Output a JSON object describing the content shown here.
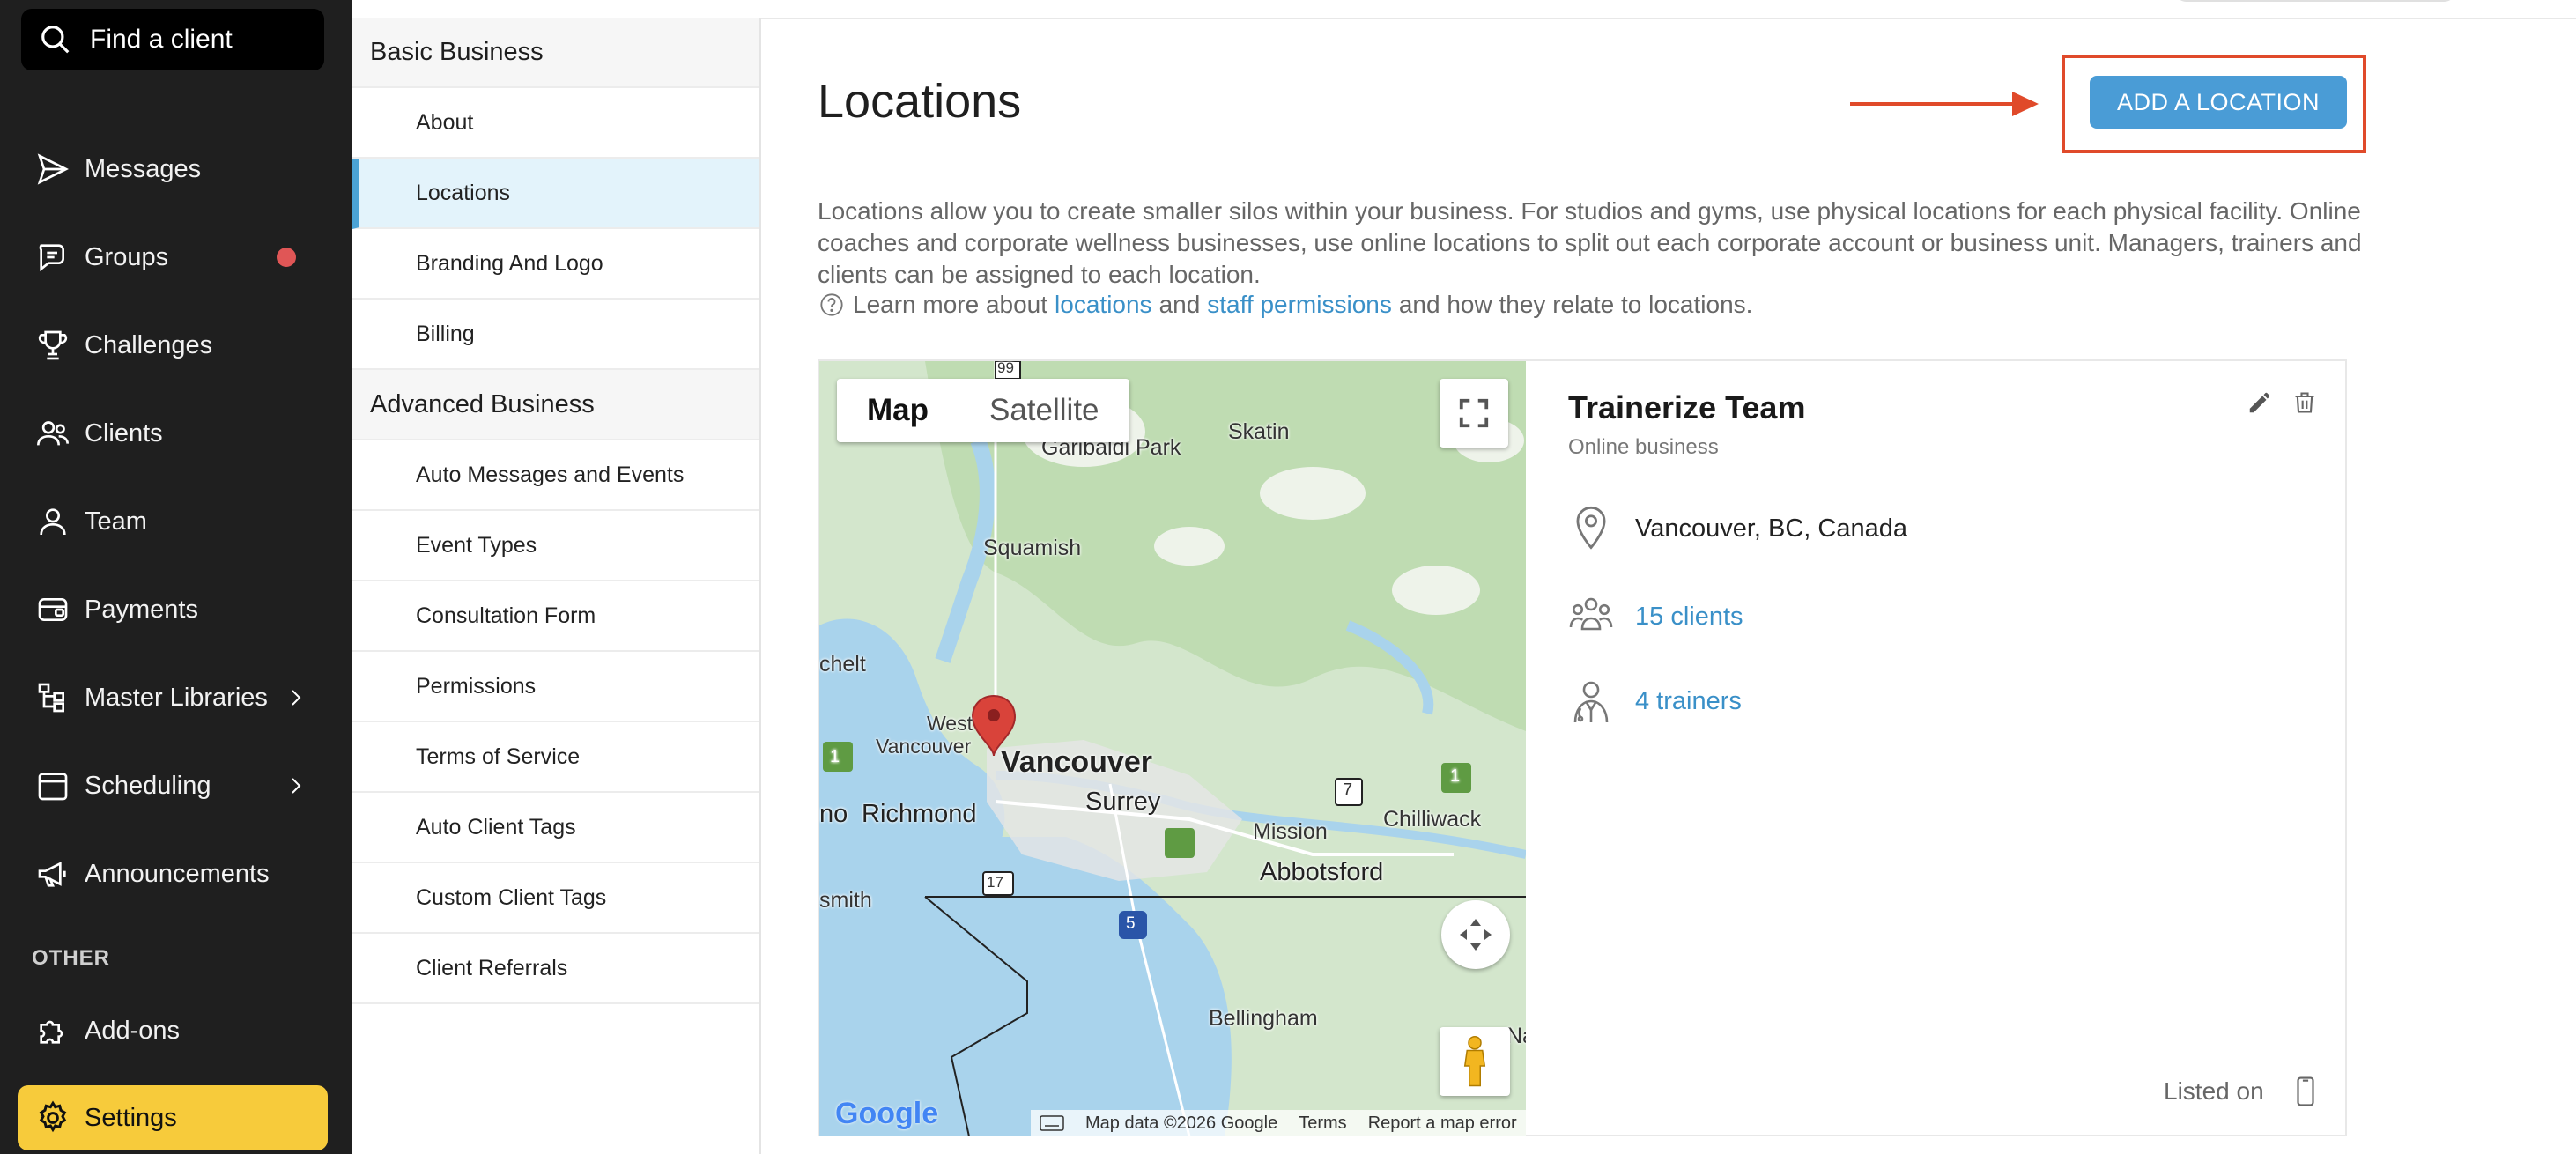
{
  "sidebar": {
    "search_label": "Find a client",
    "items": [
      {
        "label": "Messages",
        "icon": "send-icon"
      },
      {
        "label": "Groups",
        "icon": "chat-icon",
        "badge_color": "#e05656"
      },
      {
        "label": "Challenges",
        "icon": "trophy-icon"
      },
      {
        "label": "Clients",
        "icon": "people-icon"
      },
      {
        "label": "Team",
        "icon": "person-icon"
      },
      {
        "label": "Payments",
        "icon": "wallet-icon"
      },
      {
        "label": "Master Libraries",
        "icon": "library-icon",
        "has_submenu": true
      },
      {
        "label": "Scheduling",
        "icon": "calendar-icon",
        "has_submenu": true
      },
      {
        "label": "Announcements",
        "icon": "megaphone-icon"
      }
    ],
    "other_label": "OTHER",
    "addons_label": "Add-ons",
    "settings_label": "Settings",
    "active_color": "#f7cb3b"
  },
  "settings_menu": {
    "basic_title": "Basic Business",
    "basic_items": [
      "About",
      "Locations",
      "Branding And Logo",
      "Billing"
    ],
    "advanced_title": "Advanced Business",
    "advanced_items": [
      "Auto Messages and Events",
      "Event Types",
      "Consultation Form",
      "Permissions",
      "Terms of Service",
      "Auto Client Tags",
      "Custom Client Tags",
      "Client Referrals"
    ],
    "active_item": "Locations"
  },
  "main": {
    "title": "Locations",
    "add_button": "ADD A LOCATION",
    "description": "Locations allow you to create smaller silos within your business. For studios and gyms, use physical locations for each physical facility. Online coaches and corporate wellness businesses, use online locations to split out each corporate account or business unit. Managers, trainers and clients can be assigned to each location.",
    "learn": {
      "prefix": "Learn more about",
      "link1": "locations",
      "and": "and",
      "link2": "staff permissions",
      "suffix": "and how they relate to locations."
    }
  },
  "location": {
    "name": "Trainerize Team",
    "type": "Online business",
    "address": "Vancouver, BC, Canada",
    "clients": "15 clients",
    "trainers": "4 trainers",
    "listed_on": "Listed on"
  },
  "map": {
    "toggle_map": "Map",
    "toggle_satellite": "Satellite",
    "labels": {
      "garibaldi": "Garibaldi Park",
      "skatin": "Skatin",
      "squamish": "Squamish",
      "chelt": "chelt",
      "west_vancouver_1": "West",
      "west_vancouver_2": "Vancouver",
      "vancouver": "Vancouver",
      "richmond": "Richmond",
      "rich_prefix": "no",
      "surrey": "Surrey",
      "mission": "Mission",
      "chilliwack": "Chilliwack",
      "abbotsford": "Abbotsford",
      "smith": "smith",
      "bellingham": "Bellingham",
      "na": "Na",
      "hwy99": "99",
      "hwy7": "7",
      "hwy1a": "1",
      "hwy1b": "1",
      "hwy17": "17",
      "hwy5": "5"
    },
    "footer": {
      "data": "Map data ©2026 Google",
      "terms": "Terms",
      "report": "Report a map error"
    },
    "logo": "Google"
  }
}
